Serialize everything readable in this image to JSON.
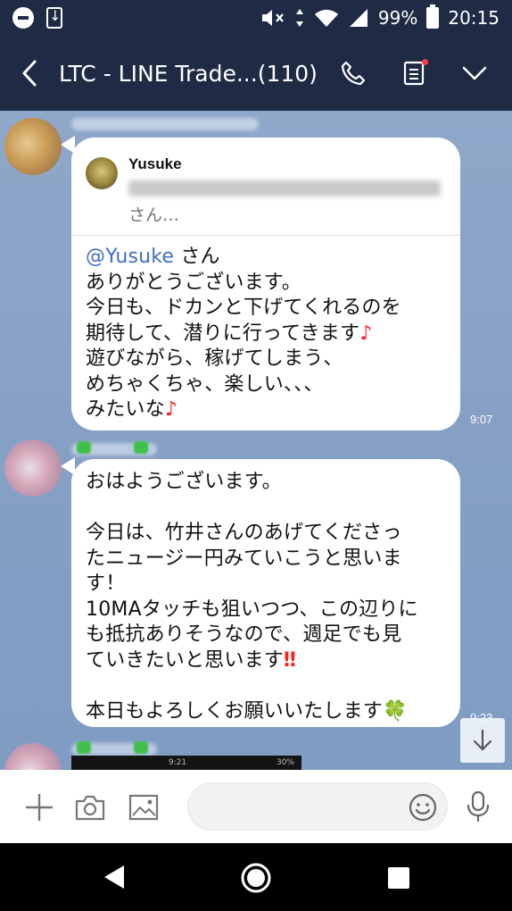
{
  "status_bar": {
    "battery": "99%",
    "time": "20:15"
  },
  "header": {
    "title": "LTC - LINE Trade...",
    "count": "(110)"
  },
  "messages": [
    {
      "reply_name": "Yusuke",
      "reply_suffix": "さん…",
      "mention": "@Yusuke",
      "text_after_mention": " さん\nありがとうございます。\n今日も、ドカンと下げてくれるのを\n期待して、潜りに行ってきます",
      "note1": "♪",
      "text_2": "\n遊びながら、稼げてしまう、\nめちゃくちゃ、楽しい、、、\nみたいな",
      "note2": "♪",
      "time": "9:07"
    },
    {
      "text": "おはようございます。\n\n今日は、竹井さんのあげてくださっ\nたニュージー円みていこうと思いま\nす！\n10MAタッチも狙いつつ、この辺りに\nも抵抗ありそうなので、週足でも見\nていきたいと思います",
      "bangs": "‼",
      "text_2": "\n\n本日もよろしくお願いいたします",
      "clover": "🍀",
      "time": "9:23"
    }
  ],
  "thumbnail": {
    "time": "9:21",
    "battery": "30%"
  },
  "colors": {
    "header_bg": "#1f2b45",
    "chat_bg": "#8aa3c7",
    "mention": "#3d6fc4"
  }
}
